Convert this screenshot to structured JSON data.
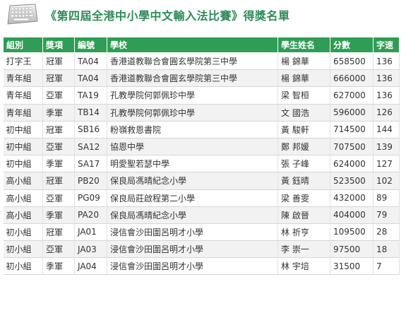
{
  "header": {
    "title": "《第四屆全港中小學中文輸入法比賽》得獎名單"
  },
  "table": {
    "columns": [
      "組別",
      "獎項",
      "編號",
      "學校",
      "學生姓名",
      "分數",
      "字速"
    ],
    "rows": [
      [
        "打字王",
        "冠軍",
        "TA04",
        "香港道教聯合會圓玄學院第三中學",
        "楊 錦華",
        "658500",
        "136"
      ],
      [
        "青年組",
        "冠軍",
        "TA04",
        "香港道教聯合會圓玄學院第三中學",
        "楊 錦華",
        "666000",
        "136"
      ],
      [
        "青年組",
        "亞軍",
        "TA19",
        "孔教學院何郭佩珍中學",
        "梁 智桓",
        "627000",
        "136"
      ],
      [
        "青年組",
        "季軍",
        "TB14",
        "孔教學院何郭佩珍中學",
        "文 國浩",
        "596000",
        "126"
      ],
      [
        "初中組",
        "冠軍",
        "SB16",
        "粉嶺救恩書院",
        "黃 駿軒",
        "714500",
        "144"
      ],
      [
        "初中組",
        "亞軍",
        "SA12",
        "協恩中學",
        "鄭 邦媛",
        "707500",
        "139"
      ],
      [
        "初中組",
        "季軍",
        "SA17",
        "明愛聖若瑟中學",
        "張 子峰",
        "624000",
        "127"
      ],
      [
        "高小組",
        "冠軍",
        "PB20",
        "保良局馮晴紀念小學",
        "黃 鈺晴",
        "523500",
        "102"
      ],
      [
        "高小組",
        "亞軍",
        "PG09",
        "保良局莊啟程第二小學",
        "梁 善雯",
        "432000",
        "89"
      ],
      [
        "高小組",
        "季軍",
        "PA20",
        "保良局馮晴紀念小學",
        "陳 啟晉",
        "404000",
        "79"
      ],
      [
        "初小組",
        "冠軍",
        "JA01",
        "浸信會沙田圍呂明才小學",
        "林 祈亨",
        "109500",
        "28"
      ],
      [
        "初小組",
        "亞軍",
        "JA03",
        "浸信會沙田圍呂明才小學",
        "李 崇一",
        "97500",
        "18"
      ],
      [
        "初小組",
        "季軍",
        "JA04",
        "浸信會沙田圍呂明才小學",
        "林 宇培",
        "31500",
        "7"
      ]
    ]
  },
  "colors": {
    "title": "#2e8b57",
    "header_bg": "#2f9d55",
    "row_alt": "#f2f2f2"
  },
  "icons": {
    "header_icon": "keyboard-icon"
  }
}
